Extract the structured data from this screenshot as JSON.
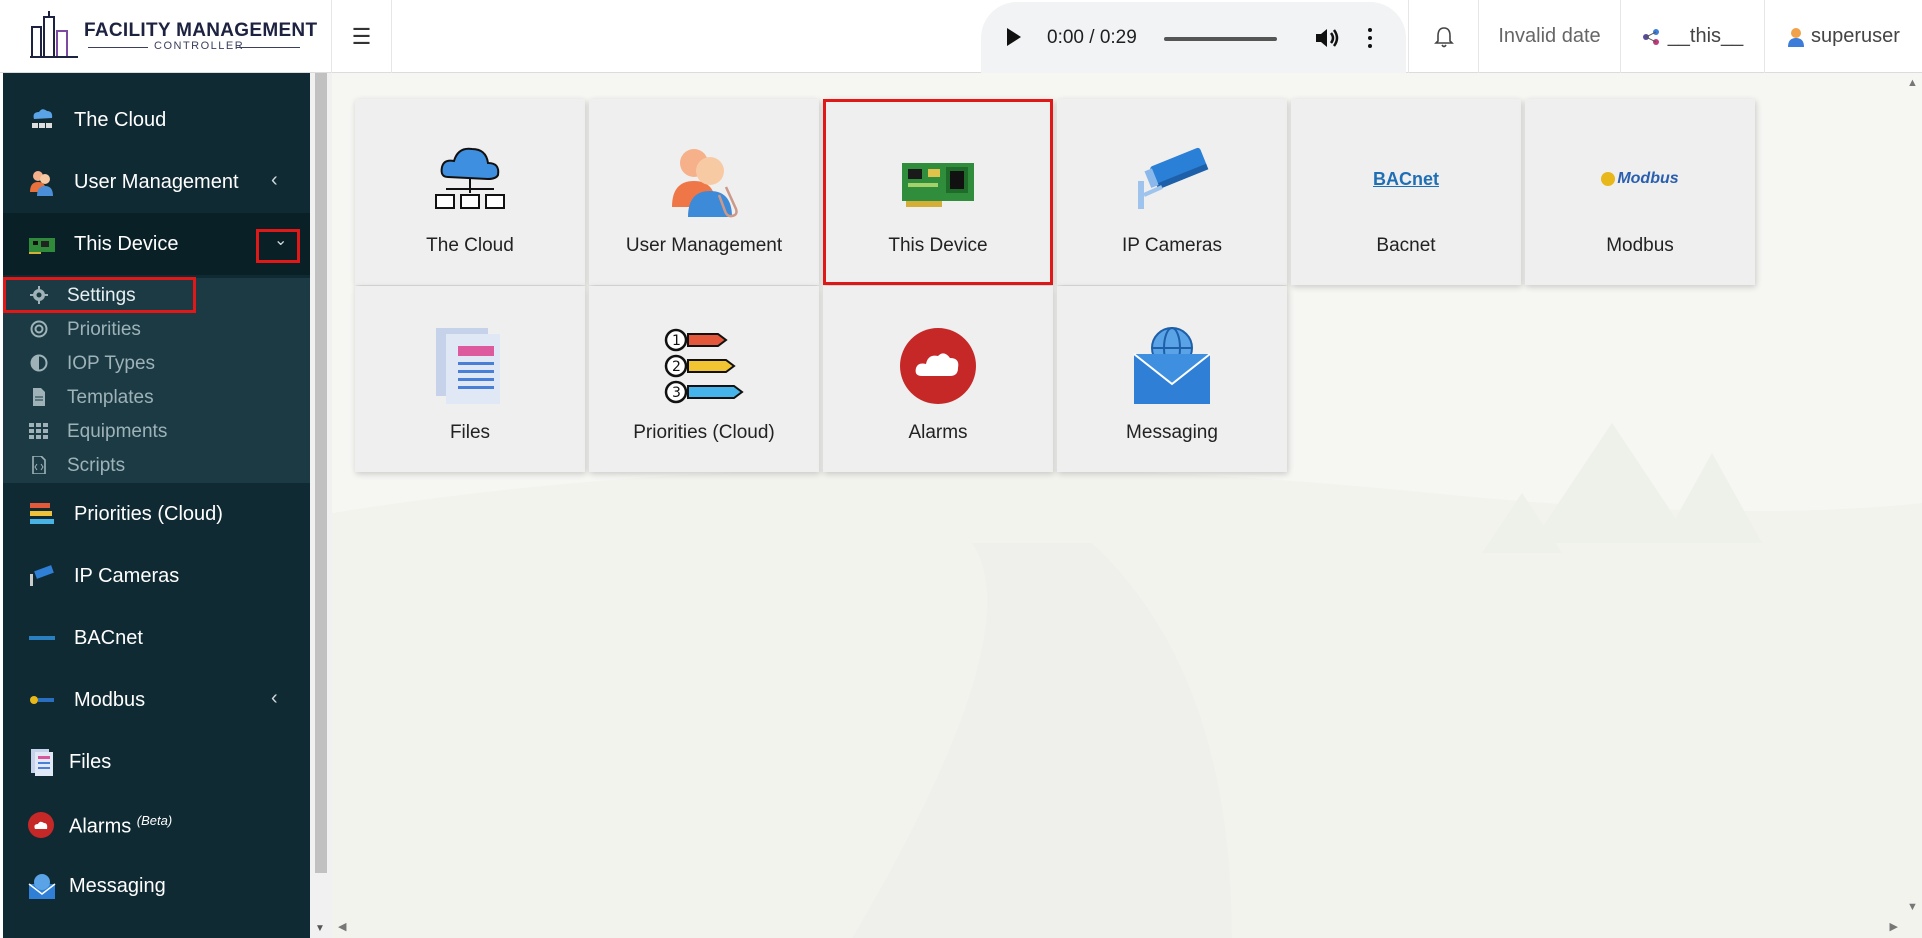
{
  "header": {
    "logo_title": "FACILITY MANAGEMENT",
    "logo_subtitle": "CONTROLLER",
    "audio_time": "0:00 / 0:29",
    "date_text": "Invalid date",
    "site_label": "__this__",
    "user_label": "superuser"
  },
  "sidebar": {
    "items": [
      {
        "label": "The Cloud"
      },
      {
        "label": "User Management",
        "chevron": "‹"
      },
      {
        "label": "This Device"
      },
      {
        "label": "Priorities (Cloud)"
      },
      {
        "label": "IP Cameras"
      },
      {
        "label": "BACnet"
      },
      {
        "label": "Modbus",
        "chevron": "‹"
      },
      {
        "label": "Files"
      },
      {
        "label": "Alarms",
        "suffix": "(Beta)"
      },
      {
        "label": "Messaging"
      }
    ],
    "this_device_sub": [
      {
        "label": "Settings",
        "icon": "gear-icon"
      },
      {
        "label": "Priorities",
        "icon": "lifebuoy-icon"
      },
      {
        "label": "IOP Types",
        "icon": "half-circle-icon"
      },
      {
        "label": "Templates",
        "icon": "file-icon"
      },
      {
        "label": "Equipments",
        "icon": "grid-icon"
      },
      {
        "label": "Scripts",
        "icon": "code-file-icon"
      }
    ]
  },
  "tiles": [
    {
      "label": "The Cloud",
      "icon": "cloud-network-icon"
    },
    {
      "label": "User Management",
      "icon": "users-icon"
    },
    {
      "label": "This Device",
      "icon": "circuit-board-icon"
    },
    {
      "label": "IP Cameras",
      "icon": "security-camera-icon"
    },
    {
      "label": "Bacnet",
      "icon": "bacnet-logo-icon"
    },
    {
      "label": "Modbus",
      "icon": "modbus-logo-icon"
    },
    {
      "label": "Files",
      "icon": "document-icon"
    },
    {
      "label": "Priorities (Cloud)",
      "icon": "priority-list-icon"
    },
    {
      "label": "Alarms",
      "icon": "alarm-cloud-icon"
    },
    {
      "label": "Messaging",
      "icon": "envelope-globe-icon"
    }
  ],
  "icon_logo_text": {
    "bacnet": "BACnet",
    "modbus": "Modbus"
  },
  "colors": {
    "sidebar_bg": "#0f2a33",
    "highlight_red": "#e01818"
  }
}
